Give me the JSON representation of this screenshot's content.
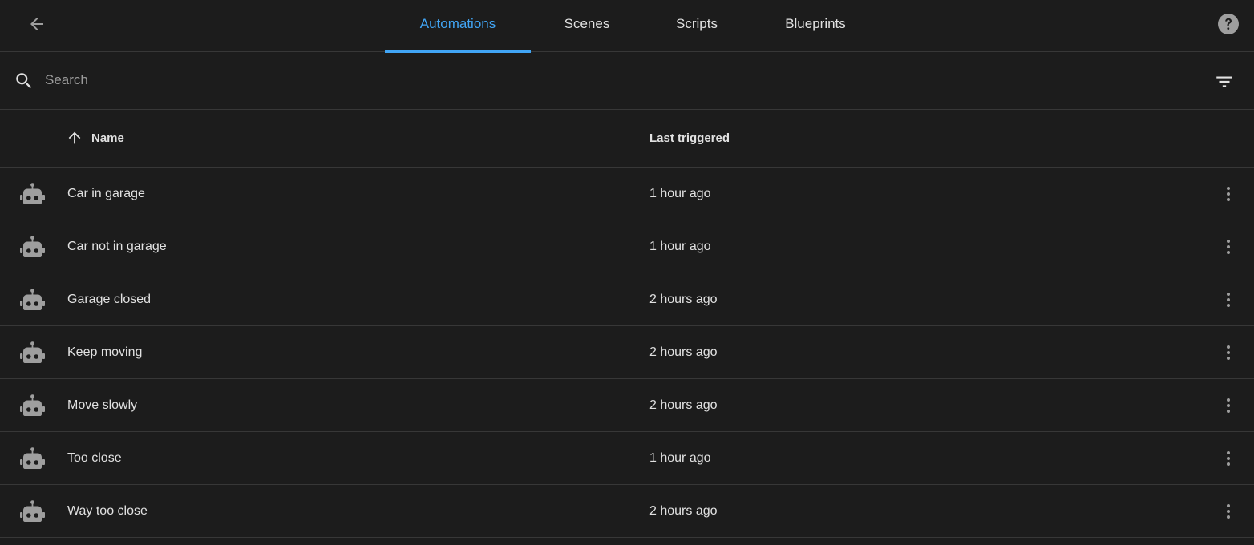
{
  "toolbar": {
    "back_icon": "arrow-left-icon",
    "help_icon": "help-circle-icon",
    "tabs": [
      {
        "label": "Automations",
        "active": true
      },
      {
        "label": "Scenes",
        "active": false
      },
      {
        "label": "Scripts",
        "active": false
      },
      {
        "label": "Blueprints",
        "active": false
      }
    ]
  },
  "search": {
    "placeholder": "Search",
    "value": "",
    "filter_icon": "filter-icon"
  },
  "table": {
    "columns": {
      "name": "Name",
      "last_triggered": "Last triggered"
    },
    "sort": {
      "column": "name",
      "direction": "ascending"
    },
    "row_icon": "robot-icon",
    "rows": [
      {
        "name": "Car in garage",
        "last_triggered": "1 hour ago"
      },
      {
        "name": "Car not in garage",
        "last_triggered": "1 hour ago"
      },
      {
        "name": "Garage closed",
        "last_triggered": "2 hours ago"
      },
      {
        "name": "Keep moving",
        "last_triggered": "2 hours ago"
      },
      {
        "name": "Move slowly",
        "last_triggered": "2 hours ago"
      },
      {
        "name": "Too close",
        "last_triggered": "1 hour ago"
      },
      {
        "name": "Way too close",
        "last_triggered": "2 hours ago"
      }
    ]
  },
  "colors": {
    "background": "#1c1c1c",
    "accent": "#41a5f5",
    "divider": "#373737",
    "text": "#e1e1e1",
    "icon": "#9e9e9e"
  }
}
